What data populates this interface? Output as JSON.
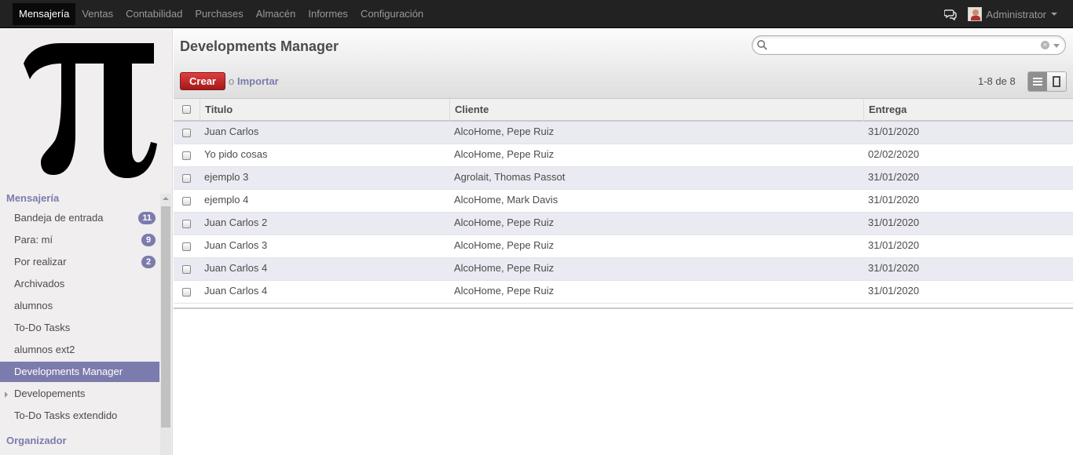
{
  "topbar": {
    "menu": [
      "Mensajería",
      "Ventas",
      "Contabilidad",
      "Purchases",
      "Almacén",
      "Informes",
      "Configuración"
    ],
    "user": "Administrator"
  },
  "sidebar": {
    "section1": "Mensajería",
    "items": [
      {
        "label": "Bandeja de entrada",
        "badge": "11"
      },
      {
        "label": "Para: mí",
        "badge": "9"
      },
      {
        "label": "Por realizar",
        "badge": "2"
      },
      {
        "label": "Archivados"
      },
      {
        "label": "alumnos"
      },
      {
        "label": "To-Do Tasks"
      },
      {
        "label": "alumnos ext2"
      },
      {
        "label": "Developments Manager",
        "active": true
      },
      {
        "label": "Developements",
        "expandable": true
      },
      {
        "label": "To-Do Tasks extendido"
      }
    ],
    "section2": "Organizador"
  },
  "main": {
    "title": "Developments Manager",
    "search": {
      "value": "",
      "placeholder": ""
    },
    "create_label": "Crear",
    "or_label": "o",
    "import_label": "Importar",
    "pager": "1-8 de 8"
  },
  "table": {
    "columns": [
      "Titulo",
      "Cliente",
      "Entrega"
    ],
    "rows": [
      [
        "Juan Carlos",
        "AlcoHome, Pepe Ruiz",
        "31/01/2020"
      ],
      [
        "Yo pido cosas",
        "AlcoHome, Pepe Ruiz",
        "02/02/2020"
      ],
      [
        "ejemplo 3",
        "Agrolait, Thomas Passot",
        "31/01/2020"
      ],
      [
        "ejemplo 4",
        "AlcoHome, Mark Davis",
        "31/01/2020"
      ],
      [
        "Juan Carlos 2",
        "AlcoHome, Pepe Ruiz",
        "31/01/2020"
      ],
      [
        "Juan Carlos 3",
        "AlcoHome, Pepe Ruiz",
        "31/01/2020"
      ],
      [
        "Juan Carlos 4",
        "AlcoHome, Pepe Ruiz",
        "31/01/2020"
      ],
      [
        "Juan Carlos 4",
        "AlcoHome, Pepe Ruiz",
        "31/01/2020"
      ]
    ]
  },
  "colors": {
    "accent": "#7c7bad",
    "create": "#c02c2c",
    "topbar": "#222222"
  },
  "icons": [
    "chat-icon",
    "pi-logo",
    "search-icon",
    "clear-icon",
    "list-view-icon",
    "form-view-icon"
  ]
}
